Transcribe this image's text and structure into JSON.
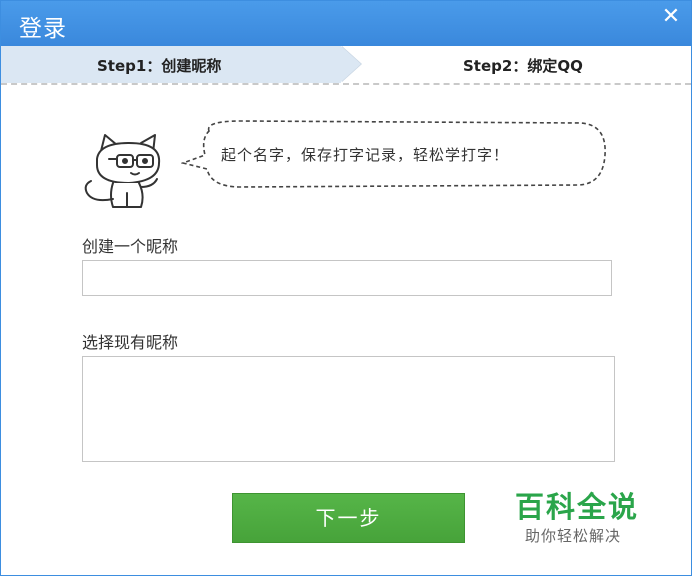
{
  "window": {
    "title": "登录",
    "close_symbol": "✕"
  },
  "steps": {
    "step1_label": "Step1：创建昵称",
    "step2_label": "Step2：绑定QQ",
    "active_step": 1
  },
  "mascot": {
    "icon": "cat-with-glasses-icon",
    "speech": "起个名字，保存打字记录，轻松学打字！"
  },
  "create_nickname": {
    "label": "创建一个昵称",
    "value": ""
  },
  "select_nickname": {
    "label": "选择现有昵称",
    "options": []
  },
  "next_button": {
    "label": "下一步",
    "color": "#4fae43"
  },
  "watermark": {
    "title": "百科全说",
    "subtitle": "助你轻松解决"
  },
  "colors": {
    "titlebar": "#3d8ee0",
    "step_active": "#dbe7f3",
    "watermark_green": "#2aa54a"
  }
}
